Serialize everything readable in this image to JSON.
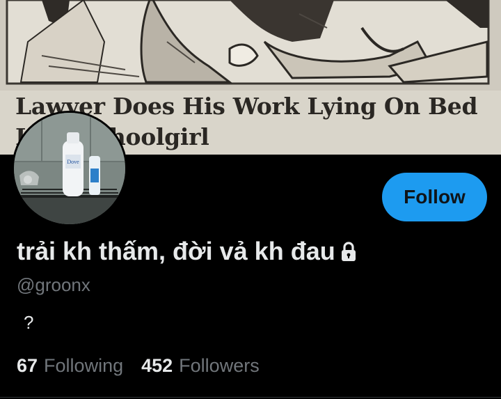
{
  "banner": {
    "headline_line1": "Lawyer Does His Work Lying On Bed",
    "headline_line2": "L          hoolgirl"
  },
  "profile": {
    "follow_label": "Follow",
    "display_name": "trải kh thấm, đời vả kh đau",
    "lock_icon": "lock-icon",
    "handle": "@groonx",
    "bio": "?",
    "following_count": "67",
    "following_label": "Following",
    "followers_count": "452",
    "followers_label": "Followers"
  },
  "colors": {
    "accent": "#1d9bf0",
    "background": "#000000",
    "text_primary": "#e7e9ea",
    "text_secondary": "#71767b"
  }
}
